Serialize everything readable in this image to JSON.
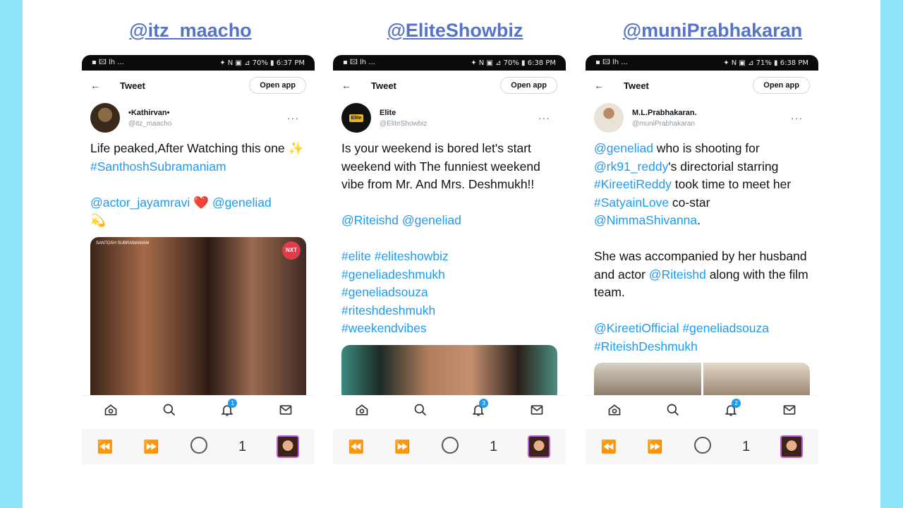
{
  "handles": [
    "@itz_maacho",
    "@EliteShowbiz",
    "@muniPrabhakaran"
  ],
  "phones": [
    {
      "status_left": "▪ 🖾 lh ...",
      "status_right": "✦ N ▣ ⊿ 70% ▮ 6:37 PM",
      "header_title": "Tweet",
      "open_app": "Open app",
      "author_name": "•Kathirvan•",
      "author_handle": "@itz_maacho",
      "text_parts": [
        {
          "t": "Life peaked,After Watching this one ✨ ",
          "link": false
        },
        {
          "t": "#SanthoshSubramaniam",
          "link": true
        },
        {
          "t": "\n\n",
          "link": false
        },
        {
          "t": "@actor_jayamravi",
          "link": true
        },
        {
          "t": " ❤️ ",
          "link": false
        },
        {
          "t": "@geneliad",
          "link": true
        },
        {
          "t": "\n💫",
          "link": false
        }
      ],
      "media_caption": "SANTOSH SUBRAMANIAM",
      "media_logo": "NXT",
      "badge": "1",
      "tab_count": "1"
    },
    {
      "status_left": "▪ 🖾 lh ...",
      "status_right": "✦ N ▣ ⊿ 70% ▮ 6:38 PM",
      "header_title": "Tweet",
      "open_app": "Open app",
      "author_name": "Elite",
      "author_handle": "@EliteShowbiz",
      "avatar_text": "Elite",
      "text_parts": [
        {
          "t": "Is your weekend is bored let's start weekend with The funniest weekend vibe from Mr. And Mrs. Deshmukh!!\n\n",
          "link": false
        },
        {
          "t": "@Riteishd",
          "link": true
        },
        {
          "t": " ",
          "link": false
        },
        {
          "t": "@geneliad",
          "link": true
        },
        {
          "t": "\n\n",
          "link": false
        },
        {
          "t": "#elite",
          "link": true
        },
        {
          "t": " ",
          "link": false
        },
        {
          "t": "#eliteshowbiz",
          "link": true
        },
        {
          "t": "\n",
          "link": false
        },
        {
          "t": "#geneliadeshmukh",
          "link": true
        },
        {
          "t": "\n",
          "link": false
        },
        {
          "t": "#geneliadsouza",
          "link": true
        },
        {
          "t": "\n",
          "link": false
        },
        {
          "t": "#riteshdeshmukh",
          "link": true
        },
        {
          "t": "\n",
          "link": false
        },
        {
          "t": "#weekendvibes",
          "link": true
        }
      ],
      "badge": "3",
      "tab_count": "1"
    },
    {
      "status_left": "▪ 🖾 lh ...",
      "status_right": "✦ N ▣ ⊿ 71% ▮ 6:38 PM",
      "header_title": "Tweet",
      "open_app": "Open app",
      "author_name": "M.L.Prabhakaran.",
      "author_handle": "@muniPrabhakaran",
      "text_parts": [
        {
          "t": "@geneliad",
          "link": true
        },
        {
          "t": " who is shooting for ",
          "link": false
        },
        {
          "t": "@rk91_reddy",
          "link": true
        },
        {
          "t": "'s directorial starring ",
          "link": false
        },
        {
          "t": "#KireetiReddy",
          "link": true
        },
        {
          "t": " took time to meet her ",
          "link": false
        },
        {
          "t": "#SatyainLove",
          "link": true
        },
        {
          "t": " co-star ",
          "link": false
        },
        {
          "t": "@NimmaShivanna",
          "link": true
        },
        {
          "t": ".\n\nShe was accompanied by her husband and actor ",
          "link": false
        },
        {
          "t": "@Riteishd",
          "link": true
        },
        {
          "t": " along with the film team.\n\n",
          "link": false
        },
        {
          "t": "@KireetiOfficial",
          "link": true
        },
        {
          "t": " ",
          "link": false
        },
        {
          "t": "#geneliadsouza",
          "link": true
        },
        {
          "t": "\n",
          "link": false
        },
        {
          "t": "#RiteishDeshmukh",
          "link": true
        }
      ],
      "badge": "2",
      "tab_count": "1"
    }
  ],
  "colors": {
    "background": "#8fe3f7",
    "handle": "#5573c8",
    "link": "#1d9bf0"
  },
  "icons": [
    "home-icon",
    "search-icon",
    "bell-icon",
    "mail-icon",
    "back-nav-icon",
    "forward-nav-icon",
    "reload-icon"
  ]
}
